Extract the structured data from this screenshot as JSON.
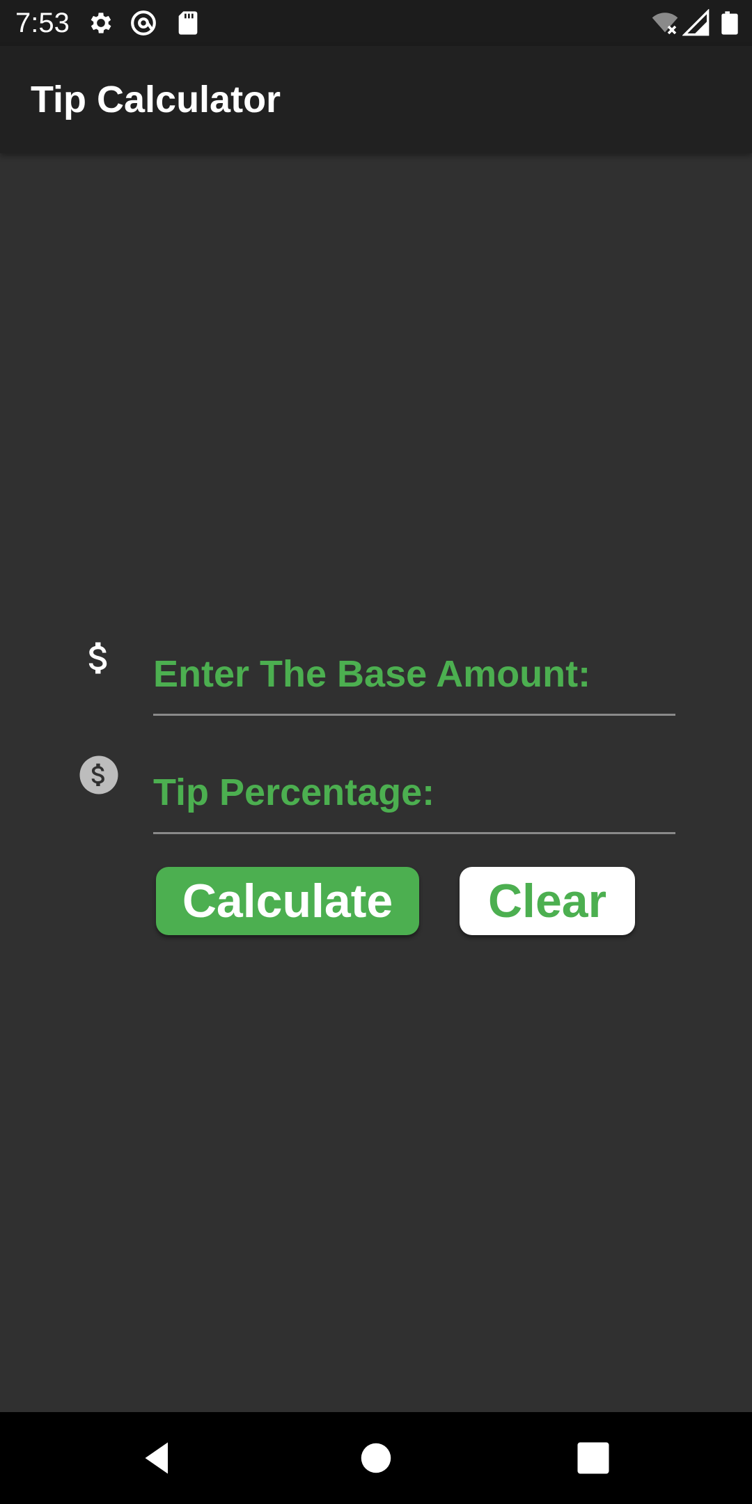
{
  "status_bar": {
    "time": "7:53",
    "icons_left": [
      "gear-icon",
      "at-sign-icon",
      "sd-card-icon"
    ],
    "icons_right": [
      "wifi-off-icon",
      "cell-signal-icon",
      "battery-icon"
    ]
  },
  "app_bar": {
    "title": "Tip Calculator"
  },
  "form": {
    "base_amount": {
      "icon": "dollar-icon",
      "placeholder": "Enter The Base Amount:",
      "value": ""
    },
    "tip_percentage": {
      "icon": "dollar-circle-icon",
      "placeholder": "Tip Percentage:",
      "value": ""
    }
  },
  "buttons": {
    "calculate_label": "Calculate",
    "clear_label": "Clear"
  },
  "nav_bar": {
    "buttons": [
      "back-icon",
      "home-icon",
      "recents-icon"
    ]
  },
  "colors": {
    "accent": "#4caf50",
    "background": "#303030",
    "app_bar": "#212121",
    "status_bar": "#1c1c1c"
  }
}
